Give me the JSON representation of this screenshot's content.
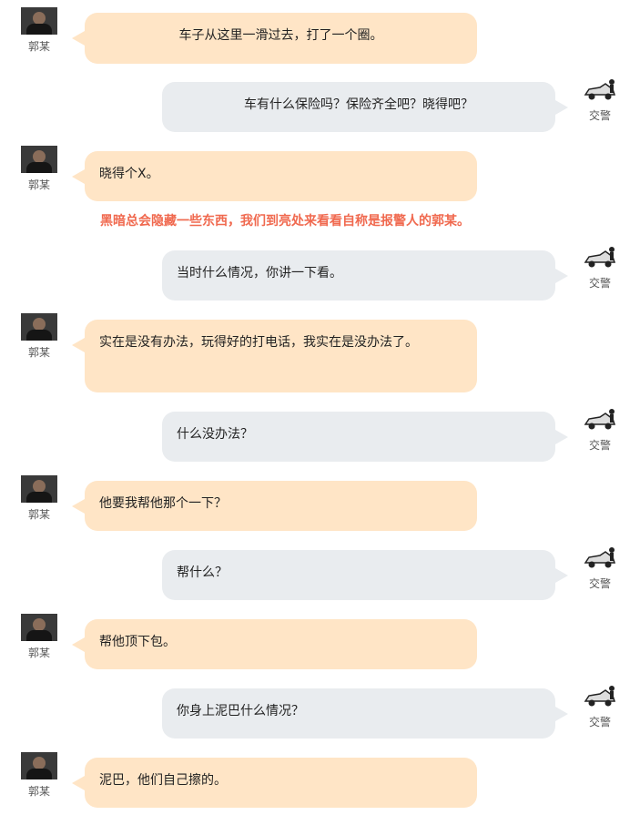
{
  "speakers": {
    "guo": "郭某",
    "police": "交警"
  },
  "messages": [
    {
      "speaker": "guo",
      "text": "车子从这里一滑过去，打了一个圈。"
    },
    {
      "speaker": "police",
      "text": "车有什么保险吗？保险齐全吧？晓得吧？"
    },
    {
      "speaker": "guo",
      "text": "晓得个X。"
    },
    {
      "speaker": "police",
      "text": "当时什么情况，你讲一下看。"
    },
    {
      "speaker": "guo",
      "text": "实在是没有办法，玩得好的打电话，我实在是没办法了。"
    },
    {
      "speaker": "police",
      "text": "什么没办法？"
    },
    {
      "speaker": "guo",
      "text": "他要我帮他那个一下？"
    },
    {
      "speaker": "police",
      "text": "帮什么？"
    },
    {
      "speaker": "guo",
      "text": "帮他顶下包。"
    },
    {
      "speaker": "police",
      "text": "你身上泥巴什么情况？"
    },
    {
      "speaker": "guo",
      "text": "泥巴，他们自己擦的。"
    }
  ],
  "caption": "黑暗总会隐藏一些东西，我们到亮处来看看自称是报警人的郭某。",
  "colors": {
    "guo_bubble": "#ffe5c6",
    "police_bubble": "#e9ecef",
    "caption": "#f0694f"
  },
  "icons": {
    "guo_avatar": "person-photo-avatar",
    "police_avatar": "police-car-avatar"
  }
}
